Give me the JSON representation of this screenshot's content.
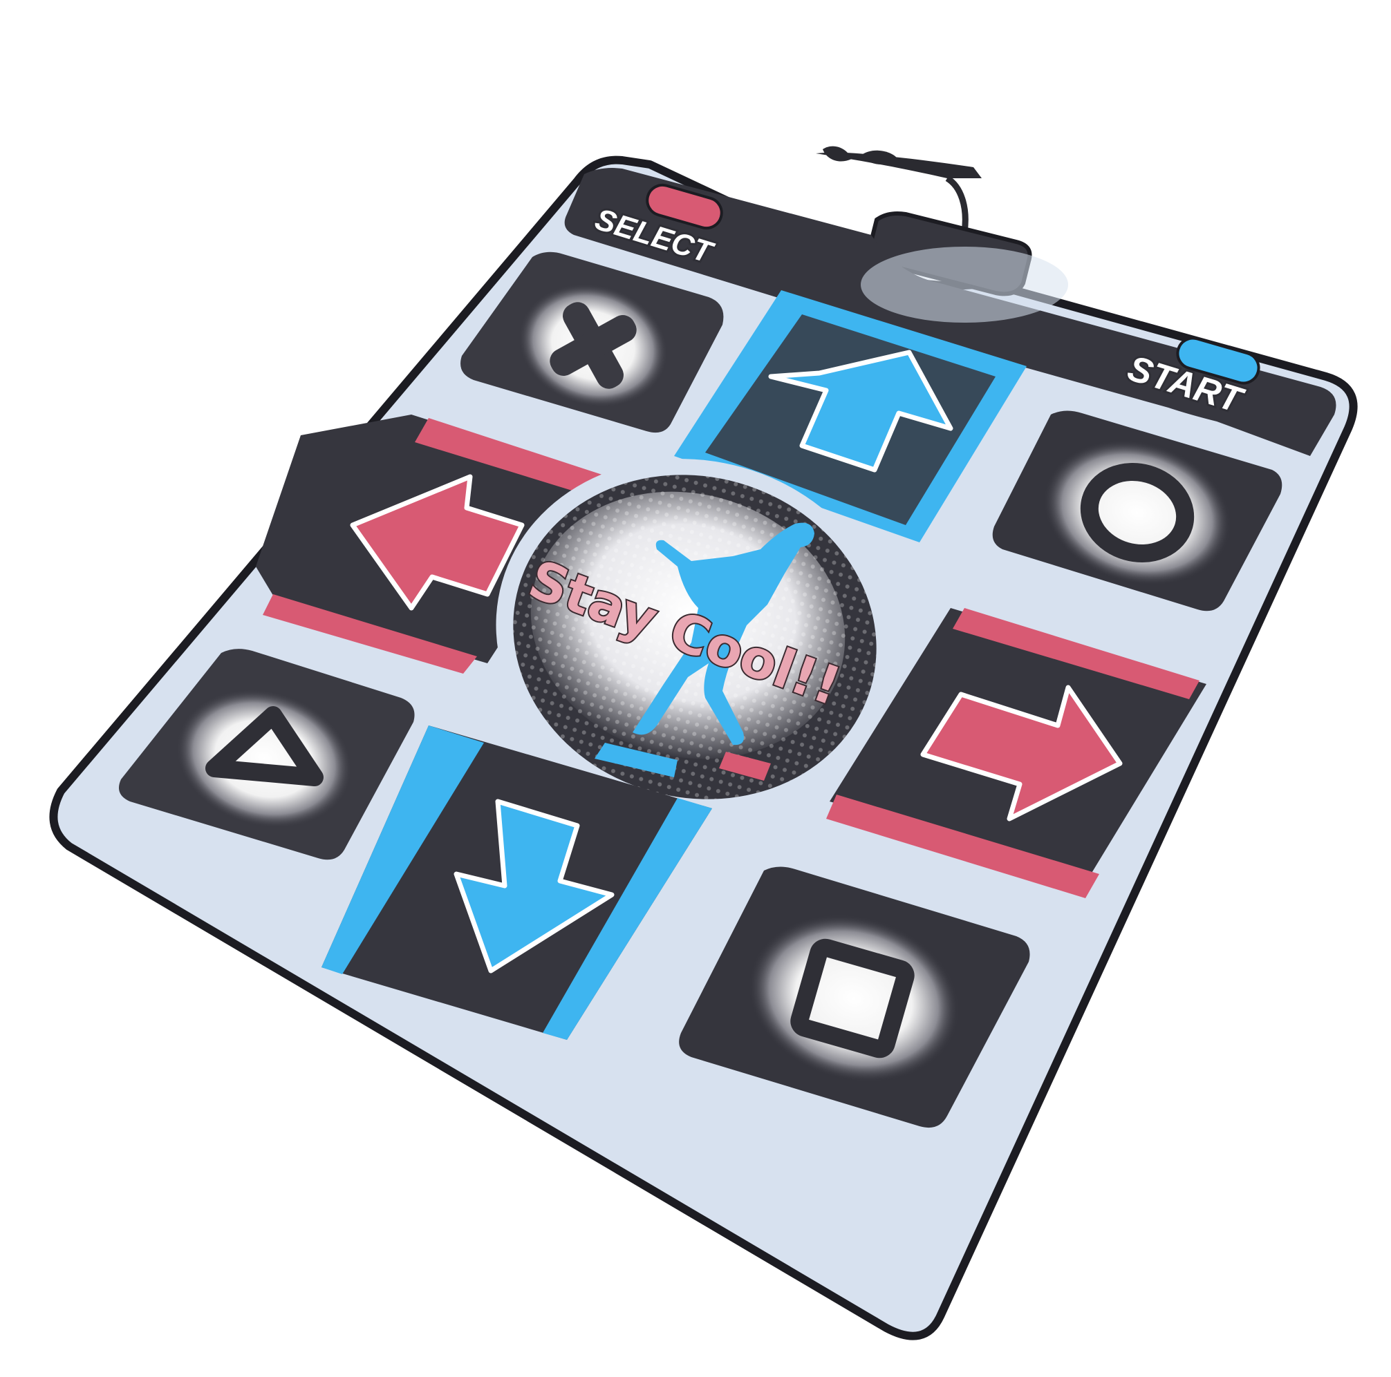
{
  "mat": {
    "select_label": "SELECT",
    "start_label": "START",
    "logo_text": "Stay Cool!!",
    "pads": {
      "top_left": "cross-icon",
      "top_right": "circle-icon",
      "bottom_left": "triangle-icon",
      "bottom_right": "square-icon",
      "up": "arrow-up-icon",
      "down": "arrow-down-icon",
      "left": "arrow-left-icon",
      "right": "arrow-right-icon"
    }
  },
  "colors": {
    "mat_base": "#d7e1ef",
    "panel_dark": "#35353d",
    "blue": "#3eb5f0",
    "pink": "#d85a73",
    "outline": "#1c1c22"
  }
}
